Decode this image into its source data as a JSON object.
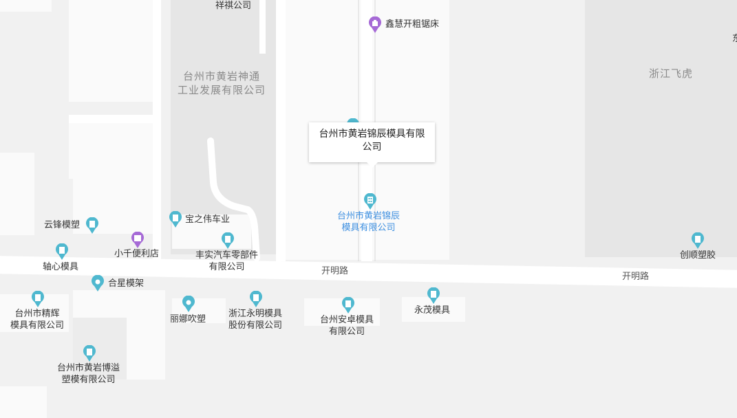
{
  "colors": {
    "poi_teal": "#4fb8cf",
    "poi_purple": "#a66ad6",
    "selected_label_blue": "#3d8fe0"
  },
  "map": {
    "roads": [
      {
        "name": "开明路"
      },
      {
        "name": "开明路"
      }
    ],
    "areas": [
      {
        "name": "台州市黄岩神通\n工业发展有限公司"
      },
      {
        "name": "浙江飞虎"
      }
    ],
    "selected_poi": {
      "callout_title": "台州市黄岩锦辰模具有限公司",
      "label": "台州市黄岩锦辰\n模具有限公司",
      "icon": "building-pin-icon"
    },
    "pois": [
      {
        "name": "祥祺公司",
        "icon": "none"
      },
      {
        "name": "鑫慧开粗锯床",
        "icon": "shop-pin-icon"
      },
      {
        "name": "云锋模塑",
        "icon": "building-pin-icon"
      },
      {
        "name": "宝之伟车业",
        "icon": "building-pin-icon"
      },
      {
        "name": "小千便利店",
        "icon": "store-pin-icon"
      },
      {
        "name": "丰实汽车零部件\n有限公司",
        "icon": "building-pin-icon"
      },
      {
        "name": "轴心模具",
        "icon": "building-pin-icon"
      },
      {
        "name": "合星模架",
        "icon": "location-pin-icon"
      },
      {
        "name": "台州市精辉\n模具有限公司",
        "icon": "building-pin-icon"
      },
      {
        "name": "丽娜吹塑",
        "icon": "location-pin-icon"
      },
      {
        "name": "浙江永明模具\n股份有限公司",
        "icon": "building-pin-icon"
      },
      {
        "name": "台州安卓模具\n有限公司",
        "icon": "building-pin-icon"
      },
      {
        "name": "永茂模具",
        "icon": "building-pin-icon"
      },
      {
        "name": "台州市黄岩博溢\n塑模有限公司",
        "icon": "building-pin-icon"
      },
      {
        "name": "创顺塑胶",
        "icon": "building-pin-icon"
      },
      {
        "name": "东",
        "icon": "none"
      }
    ]
  }
}
